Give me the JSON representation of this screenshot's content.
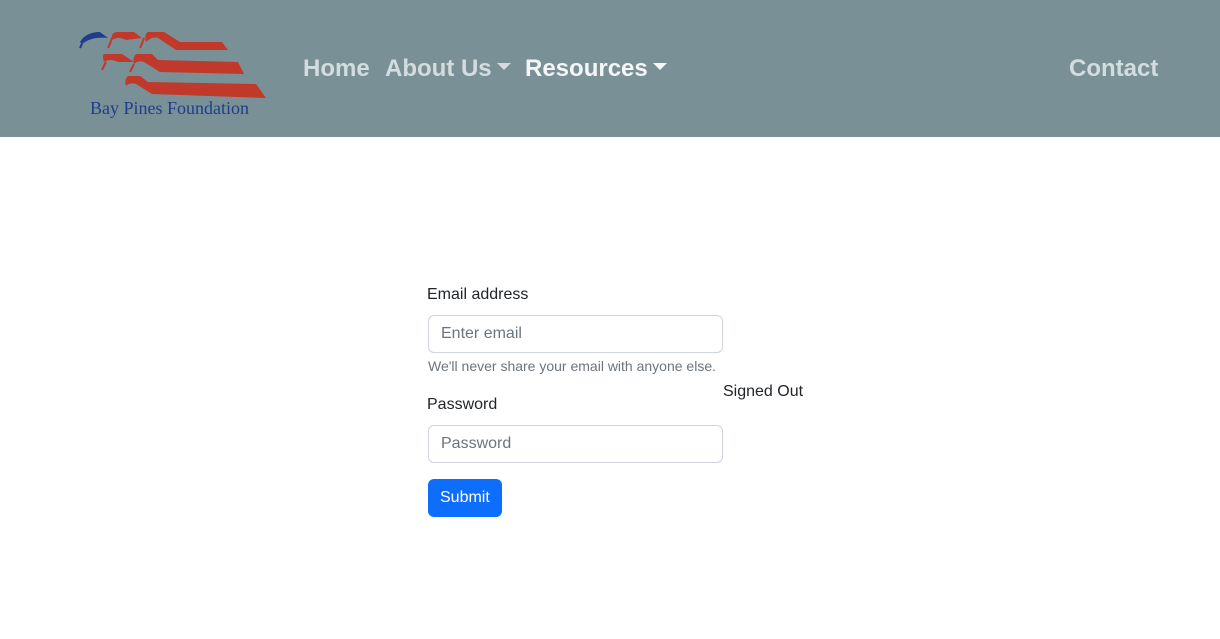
{
  "brand": {
    "logo_text": "Bay Pines Foundation",
    "logo_icon": "eagle-flag-logo",
    "colors": {
      "navy": "#1f3d8a",
      "red": "#c0392b"
    }
  },
  "nav": {
    "home": "Home",
    "about": "About Us",
    "resources": "Resources",
    "contact": "Contact",
    "background": "#7a9097"
  },
  "form": {
    "email_label": "Email address",
    "email_placeholder": "Enter email",
    "email_value": "",
    "email_help": "We'll never share your email with anyone else.",
    "password_label": "Password",
    "password_placeholder": "Password",
    "password_value": "",
    "submit_label": "Submit",
    "submit_color": "#0d6efd"
  },
  "status": {
    "text": "Signed Out"
  }
}
